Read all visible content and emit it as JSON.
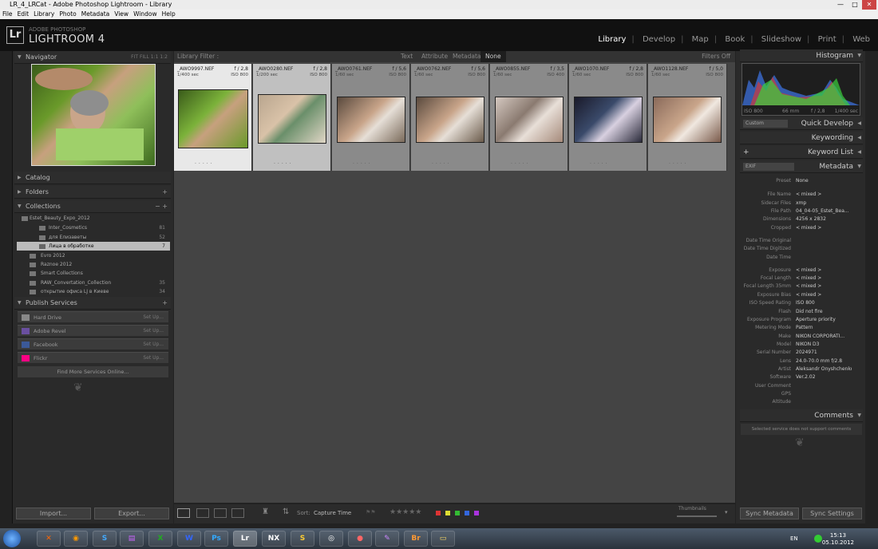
{
  "window": {
    "title": "LR_4_LRCat - Adobe Photoshop Lightroom - Library"
  },
  "menu": [
    "File",
    "Edit",
    "Library",
    "Photo",
    "Metadata",
    "View",
    "Window",
    "Help"
  ],
  "brand": {
    "logo": "Lr",
    "line1": "ADOBE PHOTOSHOP",
    "line2": "LIGHTROOM 4"
  },
  "modules": [
    "Library",
    "Develop",
    "Map",
    "Book",
    "Slideshow",
    "Print",
    "Web"
  ],
  "navigator": {
    "title": "Navigator",
    "zoom": [
      "FIT",
      "FILL",
      "1:1",
      "1:2"
    ]
  },
  "panels_left": {
    "catalog": "Catalog",
    "folders": "Folders",
    "collections": "Collections",
    "publish": "Publish Services"
  },
  "collections": [
    {
      "name": "Estet_Beauty_Expo_2012",
      "count": ""
    },
    {
      "name": "Inter_Cosmetics",
      "count": "81"
    },
    {
      "name": "для Елизаветы",
      "count": "52"
    },
    {
      "name": "Лица в обработке",
      "count": "7"
    },
    {
      "name": "Evro 2012",
      "count": ""
    },
    {
      "name": "Raznoe 2012",
      "count": ""
    },
    {
      "name": "Smart Collections",
      "count": ""
    },
    {
      "name": "RAW_Convertation_Collection",
      "count": "35"
    },
    {
      "name": "открытие офиса LJ в Киеве",
      "count": "34"
    }
  ],
  "publish": [
    {
      "name": "Hard Drive",
      "action": "Set Up..."
    },
    {
      "name": "Adobe Revel",
      "action": "Set Up..."
    },
    {
      "name": "Facebook",
      "action": "Set Up..."
    },
    {
      "name": "Flickr",
      "action": "Set Up..."
    }
  ],
  "find_more": "Find More Services Online...",
  "buttons": {
    "import": "Import...",
    "export": "Export...",
    "sync_meta": "Sync Metadata",
    "sync_settings": "Sync Settings"
  },
  "filter": {
    "label": "Library Filter :",
    "tabs": [
      "Text",
      "Attribute",
      "Metadata",
      "None"
    ],
    "status": "Filters Off"
  },
  "grid": [
    {
      "file": "_AWO9997.NEF",
      "f": "f / 2,8",
      "shutter": "1/400 sec",
      "iso": "ISO 800"
    },
    {
      "file": "_AWO0280.NEF",
      "f": "f / 2,8",
      "shutter": "1/200 sec",
      "iso": "ISO 800"
    },
    {
      "file": "_AWO0761.NEF",
      "f": "f / 5,6",
      "shutter": "1/60 sec",
      "iso": "ISO 800"
    },
    {
      "file": "_AWO0762.NEF",
      "f": "f / 5,6",
      "shutter": "1/60 sec",
      "iso": "ISO 800"
    },
    {
      "file": "_AWO0855.NEF",
      "f": "f / 3,5",
      "shutter": "1/60 sec",
      "iso": "ISO 400"
    },
    {
      "file": "_AWO1070.NEF",
      "f": "f / 2,8",
      "shutter": "1/60 sec",
      "iso": "ISO 800"
    },
    {
      "file": "_AWO1128.NEF",
      "f": "f / 5,0",
      "shutter": "1/60 sec",
      "iso": "ISO 800"
    }
  ],
  "toolbar": {
    "sort_label": "Sort:",
    "sort_value": "Capture Time",
    "thumbnails": "Thumbnails"
  },
  "histogram": {
    "title": "Histogram",
    "iso": "ISO 800",
    "focal": "66 mm",
    "aperture": "f / 2,8",
    "shutter": "1/400 sec"
  },
  "right_panels": {
    "quick": "Quick Develop",
    "keywording": "Keywording",
    "keyword_list": "Keyword List",
    "metadata": "Metadata",
    "comments": "Comments",
    "quick_preset": "Custom",
    "exif": "EXIF"
  },
  "metadata": [
    {
      "label": "Preset",
      "value": "None"
    },
    {
      "label": "File Name",
      "value": "< mixed >"
    },
    {
      "label": "Sidecar Files",
      "value": "xmp"
    },
    {
      "label": "File Path",
      "value": "04_04-05_Estet_Bea..."
    },
    {
      "label": "Dimensions",
      "value": "4256 x 2832"
    },
    {
      "label": "Cropped",
      "value": "< mixed >"
    },
    {
      "label": "Date Time Original",
      "value": ""
    },
    {
      "label": "Date Time Digitized",
      "value": ""
    },
    {
      "label": "Date Time",
      "value": ""
    },
    {
      "label": "Exposure",
      "value": "< mixed >"
    },
    {
      "label": "Focal Length",
      "value": "< mixed >"
    },
    {
      "label": "Focal Length 35mm",
      "value": "< mixed >"
    },
    {
      "label": "Exposure Bias",
      "value": "< mixed >"
    },
    {
      "label": "ISO Speed Rating",
      "value": "ISO 800"
    },
    {
      "label": "Flash",
      "value": "Did not fire"
    },
    {
      "label": "Exposure Program",
      "value": "Aperture priority"
    },
    {
      "label": "Metering Mode",
      "value": "Pattern"
    },
    {
      "label": "Make",
      "value": "NIKON CORPORATI..."
    },
    {
      "label": "Model",
      "value": "NIKON D3"
    },
    {
      "label": "Serial Number",
      "value": "2024971"
    },
    {
      "label": "Lens",
      "value": "24.0-70.0 mm f/2.8"
    },
    {
      "label": "Artist",
      "value": "Aleksandr Onyshchenko"
    },
    {
      "label": "Software",
      "value": "Ver.2.02"
    },
    {
      "label": "User Comment",
      "value": ""
    },
    {
      "label": "GPS",
      "value": ""
    },
    {
      "label": "Altitude",
      "value": ""
    }
  ],
  "comments_note": "Selected service does not support comments",
  "taskbar": {
    "lang": "EN",
    "time": "15:13",
    "date": "05.10.2012"
  }
}
